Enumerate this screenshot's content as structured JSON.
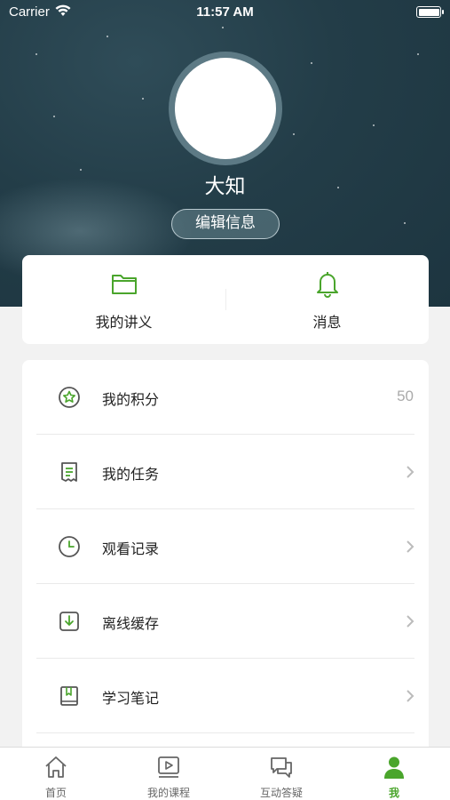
{
  "status_bar": {
    "carrier": "Carrier",
    "time": "11:57 AM"
  },
  "profile": {
    "name": "大知",
    "edit_label": "编辑信息"
  },
  "quick_actions": [
    {
      "label": "我的讲义",
      "icon": "folder-icon"
    },
    {
      "label": "消息",
      "icon": "bell-icon"
    }
  ],
  "menu": [
    {
      "label": "我的积分",
      "icon": "star-badge-icon",
      "value": "50"
    },
    {
      "label": "我的任务",
      "icon": "task-list-icon"
    },
    {
      "label": "观看记录",
      "icon": "clock-icon"
    },
    {
      "label": "离线缓存",
      "icon": "download-icon"
    },
    {
      "label": "学习笔记",
      "icon": "notebook-icon"
    }
  ],
  "tabs": [
    {
      "label": "首页",
      "icon": "home-icon"
    },
    {
      "label": "我的课程",
      "icon": "video-play-icon"
    },
    {
      "label": "互动答疑",
      "icon": "chat-icon"
    },
    {
      "label": "我",
      "icon": "person-icon",
      "active": true
    }
  ],
  "colors": {
    "accent": "#4aa52c",
    "hero": "#233d48",
    "background": "#f2f2f2"
  }
}
